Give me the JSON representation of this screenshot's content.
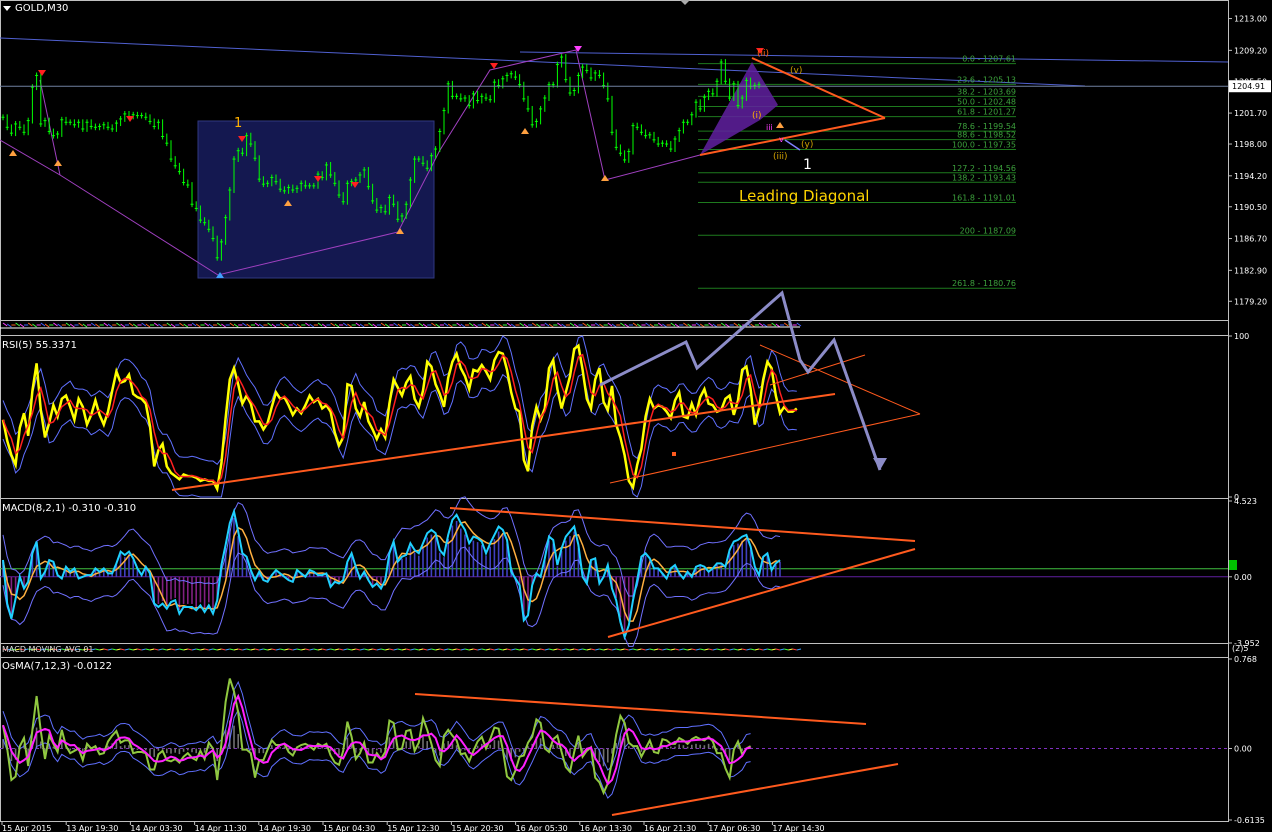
{
  "colors": {
    "background": "#000000",
    "grid_border": "#c0c0c0",
    "axis_text": "#ffffff",
    "price_line": "#00c000",
    "blue_box": "#141850",
    "trend_blue": "#5060d0",
    "orange": "#ff5a1e",
    "arrow_gray": "#8c8cc8",
    "fib": "#1e7a1e",
    "fib_text": "#3ca03c",
    "rsi_yellow": "#ffff00",
    "rsi_red": "#ff2020",
    "macd_cyan": "#20d0ff",
    "osma_green": "#90c840",
    "osma_magenta": "#ff20ff",
    "band_blue": "#8080ff"
  },
  "chart_data": [
    {
      "id": "price",
      "type": "line",
      "title": "GOLD,M30",
      "ylim": [
        1177.2,
        1215.1
      ],
      "yticks": [
        "1213.00",
        "1209.20",
        "1205.50",
        "1201.70",
        "1198.00",
        "1194.20",
        "1190.50",
        "1186.70",
        "1182.90",
        "1179.20"
      ],
      "current_price": "1204.91",
      "series": [
        {
          "values": [
            1201.2,
            1200.0,
            1199.3,
            1200.4,
            1200.0,
            1199.4,
            1200.8,
            1204.8,
            1206.2,
            1200.4,
            1200.8,
            1199.5,
            1199.0,
            1199.2,
            1200.9,
            1200.6,
            1200.6,
            1200.3,
            1200.6,
            1199.8,
            1200.6,
            1200.1,
            1200.0,
            1200.1,
            1200.3,
            1200.0,
            1199.8,
            1200.5,
            1201.0,
            1201.6,
            1201.3,
            1201.5,
            1201.4,
            1201.4,
            1201.2,
            1200.7,
            1200.1,
            1200.6,
            1198.9,
            1198.1,
            1196.2,
            1195.4,
            1194.7,
            1193.4,
            1193.1,
            1190.8,
            1190.3,
            1188.9,
            1188.6,
            1187.8,
            1186.7,
            1184.4,
            1186.3,
            1189.2,
            1192.5,
            1196.2,
            1197.2,
            1196.9,
            1199.0,
            1198.0,
            1196.3,
            1193.8,
            1193.2,
            1193.3,
            1194.0,
            1193.5,
            1192.6,
            1192.4,
            1192.8,
            1192.5,
            1192.7,
            1193.3,
            1193.0,
            1193.0,
            1193.0,
            1194.4,
            1194.0,
            1195.5,
            1194.3,
            1193.3,
            1191.9,
            1191.1,
            1193.3,
            1193.5,
            1193.7,
            1194.3,
            1194.9,
            1192.9,
            1191.2,
            1190.1,
            1190.4,
            1189.9,
            1191.6,
            1190.8,
            1189.0,
            1189.4,
            1190.8,
            1193.7,
            1196.2,
            1196.2,
            1195.7,
            1195.1,
            1196.6,
            1197.4,
            1199.5,
            1202.0,
            1205.2,
            1203.7,
            1203.7,
            1203.4,
            1203.5,
            1202.6,
            1204.0,
            1203.2,
            1203.7,
            1203.5,
            1203.3,
            1205.4,
            1205.0,
            1205.8,
            1206.2,
            1206.4,
            1206.0,
            1205.1,
            1203.4,
            1202.2,
            1200.3,
            1200.7,
            1202.2,
            1203.5,
            1205.1,
            1205.1,
            1207.5,
            1208.4,
            1205.7,
            1204.1,
            1204.4,
            1206.2,
            1207.2,
            1206.8,
            1205.9,
            1206.5,
            1206.2,
            1205.0,
            1203.4,
            1199.4,
            1197.6,
            1196.9,
            1196.1,
            1197.1,
            1200.2,
            1200.0,
            1199.4,
            1199.0,
            1199.1,
            1198.5,
            1198.0,
            1198.1,
            1198.0,
            1197.4,
            1198.6,
            1199.6,
            1200.6,
            1200.6,
            1201.5,
            1203.0,
            1202.2,
            1203.6,
            1204.3,
            1204.0,
            1205.5,
            1207.8,
            1205.5,
            1203.5,
            1205.2,
            1202.6,
            1203.5,
            1205.6,
            1204.9,
            1205.0,
            1205.1
          ]
        }
      ],
      "annotations": {
        "box_label": "1",
        "triangle_label": "Leading Diagonal",
        "wave_top": "(ii)",
        "wave_v": "(v)",
        "wave_i": "(i)",
        "wave_small_iii": "iii",
        "wave_small_v": "v",
        "wave_y": "(y)",
        "wave_iii": "(iii)",
        "wave_one": "1",
        "fib_levels": [
          {
            "label": "0.0 - 1207.61",
            "price": 1207.61
          },
          {
            "label": "23.6 - 1205.13",
            "price": 1205.13
          },
          {
            "label": "38.2 - 1203.69",
            "price": 1203.69
          },
          {
            "label": "50.0 - 1202.48",
            "price": 1202.48
          },
          {
            "label": "61.8 - 1201.27",
            "price": 1201.27
          },
          {
            "label": "78.6 - 1199.54",
            "price": 1199.54
          },
          {
            "label": "88.6 - 1198.52",
            "price": 1198.52
          },
          {
            "label": "100.0 - 1197.35",
            "price": 1197.35
          },
          {
            "label": "127.2 - 1194.56",
            "price": 1194.56
          },
          {
            "label": "138.2 - 1193.43",
            "price": 1193.43
          },
          {
            "label": "161.8 - 1191.01",
            "price": 1191.01
          },
          {
            "label": "200 - 1187.09",
            "price": 1187.09
          },
          {
            "label": "261.8 - 1180.76",
            "price": 1180.76
          }
        ]
      }
    },
    {
      "id": "rsi",
      "type": "line",
      "title": "RSI(5) 55.3371",
      "ylim": [
        0,
        100
      ],
      "yticks": [
        "100",
        "0"
      ],
      "series": [
        {
          "name": "RSI",
          "values": [
            48,
            35,
            26,
            20,
            43,
            52,
            38,
            66,
            83,
            54,
            37,
            46,
            57,
            50,
            61,
            63,
            56,
            48,
            61,
            56,
            45,
            51,
            60,
            51,
            45,
            53,
            66,
            78,
            71,
            72,
            76,
            64,
            62,
            61,
            58,
            44,
            19,
            29,
            33,
            19,
            15,
            13,
            11,
            14,
            13,
            13,
            12,
            10,
            11,
            10,
            10,
            5,
            21,
            49,
            73,
            80,
            70,
            58,
            63,
            58,
            47,
            47,
            42,
            46,
            56,
            65,
            61,
            62,
            57,
            51,
            55,
            52,
            57,
            63,
            59,
            61,
            55,
            57,
            53,
            40,
            32,
            37,
            70,
            69,
            55,
            50,
            59,
            47,
            42,
            36,
            42,
            37,
            58,
            73,
            68,
            63,
            71,
            75,
            61,
            56,
            66,
            84,
            81,
            70,
            64,
            56,
            74,
            84,
            89,
            80,
            75,
            67,
            79,
            78,
            82,
            78,
            73,
            85,
            90,
            89,
            79,
            65,
            55,
            53,
            23,
            16,
            44,
            56,
            48,
            55,
            80,
            85,
            67,
            55,
            65,
            75,
            92,
            94,
            79,
            61,
            55,
            73,
            80,
            59,
            54,
            69,
            45,
            37,
            26,
            10,
            6,
            20,
            30,
            50,
            61,
            55,
            57,
            56,
            53,
            49,
            60,
            65,
            50,
            49,
            58,
            51,
            62,
            67,
            58,
            57,
            53,
            54,
            61,
            63,
            51,
            60,
            79,
            81,
            67,
            45,
            55,
            73,
            84,
            80,
            63,
            52,
            56,
            53,
            53,
            55
          ]
        }
      ]
    },
    {
      "id": "macd",
      "type": "line",
      "title": "MACD(8,2,1) -0.310 -0.310",
      "ylim": [
        -3.952,
        4.523
      ],
      "yticks": [
        "4.523",
        "0.00",
        "-3.952"
      ],
      "series": [
        {
          "name": "MACD",
          "values": [
            1.0,
            -1.6,
            -2.5,
            -1.3,
            -0.0,
            -0.7,
            -0.3,
            1.4,
            2.1,
            -0.1,
            0.3,
            1.0,
            0.9,
            0.1,
            -0.1,
            0.6,
            0.3,
            0.5,
            -0.1,
            -0.0,
            0.1,
            0.1,
            0.5,
            0.3,
            0.5,
            0.2,
            0.2,
            0.8,
            1.5,
            1.3,
            1.5,
            1.1,
            0.5,
            0.1,
            0.6,
            0.2,
            -1.6,
            -1.8,
            -1.6,
            -1.9,
            -1.5,
            -1.4,
            -2.2,
            -1.8,
            -1.8,
            -1.8,
            -2.0,
            -1.7,
            -2.1,
            -1.7,
            -2.2,
            -1.4,
            0.7,
            1.9,
            3.2,
            3.9,
            2.7,
            1.4,
            1.2,
            0.4,
            -0.2,
            0.3,
            -0.2,
            -0.3,
            0.1,
            0.4,
            0.2,
            -0.0,
            -0.2,
            -0.3,
            0.4,
            0.2,
            -0.0,
            0.4,
            0.3,
            0.1,
            0.1,
            0.2,
            -0.6,
            -0.3,
            -0.4,
            -0.2,
            0.9,
            1.4,
            0.6,
            -0.1,
            0.3,
            -0.2,
            -0.6,
            -0.4,
            -0.7,
            -0.2,
            1.4,
            2.1,
            0.9,
            1.2,
            1.3,
            2.0,
            1.6,
            1.4,
            2.0,
            2.6,
            2.8,
            2.6,
            1.6,
            1.3,
            2.5,
            3.4,
            3.7,
            3.2,
            2.8,
            2.0,
            2.4,
            2.3,
            2.1,
            1.4,
            2.0,
            2.5,
            3.0,
            2.8,
            2.2,
            0.3,
            -0.1,
            -0.5,
            -2.6,
            -2.3,
            -0.5,
            0.2,
            0.0,
            1.1,
            2.4,
            2.2,
            0.7,
            1.7,
            2.4,
            2.7,
            3.0,
            1.9,
            -0.0,
            -0.4,
            1.0,
            1.1,
            -0.4,
            -0.0,
            0.7,
            -0.7,
            -1.4,
            -2.7,
            -3.6,
            -2.9,
            -1.4,
            -0.2,
            1.2,
            1.4,
            1.1,
            0.5,
            0.5,
            0.2,
            -0.1,
            0.5,
            0.7,
            0.2,
            -0.1,
            0.3,
            -0.0,
            0.6,
            0.7,
            0.6,
            0.3,
            0.5,
            0.8,
            0.8,
            0.6,
            1.6,
            2.1,
            2.2,
            2.4,
            2.5,
            1.8,
            0.6,
            0.1,
            1.2,
            1.4,
            0.4,
            0.8,
            1.0
          ]
        }
      ]
    },
    {
      "id": "osma",
      "type": "line",
      "title": "OsMA(7,12,3) -0.0122",
      "ylim": [
        -0.6135,
        0.768
      ],
      "yticks": [
        "0.768",
        "0.00",
        "-0.6135"
      ],
      "series": [
        {
          "name": "OsMA",
          "values": [
            0.2,
            0.0,
            -0.27,
            -0.24,
            0.02,
            0.09,
            -0.15,
            0.16,
            0.45,
            0.15,
            -0.09,
            0.11,
            0.04,
            -0.03,
            0.16,
            0.02,
            -0.04,
            -0.02,
            0.0,
            -0.1,
            0.04,
            0.0,
            0.02,
            -0.05,
            -0.04,
            0.06,
            0.11,
            0.15,
            0.05,
            0.07,
            0.07,
            -0.04,
            -0.03,
            -0.03,
            -0.04,
            -0.18,
            -0.18,
            -0.05,
            -0.02,
            -0.1,
            -0.11,
            -0.09,
            -0.12,
            -0.07,
            -0.04,
            -0.08,
            -0.1,
            -0.02,
            -0.09,
            0.05,
            0.0,
            -0.27,
            0.04,
            0.4,
            0.6,
            0.49,
            0.31,
            -0.01,
            -0.01,
            -0.04,
            -0.25,
            -0.1,
            -0.1,
            -0.01,
            0.07,
            0.03,
            0.03,
            0.04,
            -0.03,
            -0.06,
            0.01,
            0.03,
            0.04,
            0.02,
            -0.01,
            0.04,
            0.02,
            0.04,
            -0.06,
            -0.12,
            -0.14,
            -0.02,
            0.23,
            0.1,
            -0.09,
            -0.04,
            0.05,
            -0.12,
            -0.12,
            -0.04,
            -0.09,
            -0.03,
            0.24,
            0.22,
            -0.01,
            0.0,
            0.15,
            0.16,
            -0.02,
            0.05,
            0.26,
            0.16,
            0.04,
            -0.1,
            -0.15,
            0.11,
            0.16,
            0.11,
            0.07,
            -0.05,
            -0.04,
            -0.11,
            -0.02,
            0.06,
            0.1,
            0.0,
            0.08,
            0.18,
            0.17,
            -0.01,
            -0.24,
            -0.27,
            -0.19,
            -0.07,
            -0.06,
            0.05,
            0.1,
            0.25,
            0.22,
            0.0,
            -0.03,
            0.08,
            0.11,
            -0.03,
            -0.16,
            -0.2,
            -0.03,
            0.11,
            -0.07,
            -0.02,
            0.01,
            -0.25,
            -0.29,
            -0.38,
            -0.3,
            -0.11,
            0.12,
            0.28,
            0.22,
            0.05,
            0.02,
            0.02,
            -0.07,
            0.0,
            0.07,
            -0.03,
            -0.04,
            0.08,
            0.07,
            0.04,
            0.04,
            0.09,
            0.07,
            0.04,
            0.08,
            0.1,
            0.08,
            0.07,
            0.1,
            0.06,
            -0.04,
            -0.04,
            -0.17,
            -0.25,
            -0.01,
            0.06,
            -0.05,
            0.0,
            0.02
          ]
        }
      ]
    }
  ],
  "labels": {
    "ind_mini_text": "Indicators MOVING AVG (3)",
    "macd_mini_text": "MACD MOVING AVG 01",
    "macd_mini_scale": "(2)5",
    "time_axis": [
      "15 Apr 2015",
      "13 Apr 19:30",
      "14 Apr 03:30",
      "14 Apr 11:30",
      "14 Apr 19:30",
      "15 Apr 04:30",
      "15 Apr 12:30",
      "15 Apr 20:30",
      "16 Apr 05:30",
      "16 Apr 13:30",
      "16 Apr 21:30",
      "17 Apr 06:30",
      "17 Apr 14:30"
    ]
  }
}
